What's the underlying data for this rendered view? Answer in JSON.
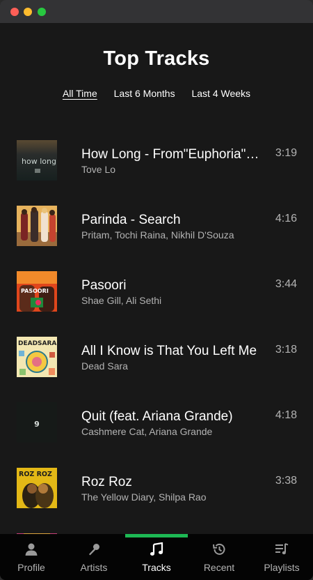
{
  "page": {
    "title": "Top Tracks"
  },
  "ranges": [
    {
      "label": "All Time",
      "active": true
    },
    {
      "label": "Last 6 Months",
      "active": false
    },
    {
      "label": "Last 4 Weeks",
      "active": false
    }
  ],
  "tracks": [
    {
      "name": "How Long - From\"Euphoria\" An HBO Original Series",
      "artists": "Tove Lo",
      "duration": "3:19",
      "cover_text": "how long"
    },
    {
      "name": "Parinda - Search",
      "artists": "Pritam, Tochi Raina, Nikhil D'Souza",
      "duration": "4:16",
      "cover_text": ""
    },
    {
      "name": "Pasoori",
      "artists": "Shae Gill, Ali Sethi",
      "duration": "3:44",
      "cover_text": "PASOORI"
    },
    {
      "name": "All I Know is That You Left Me",
      "artists": "Dead Sara",
      "duration": "3:18",
      "cover_text": "DEADSARA"
    },
    {
      "name": "Quit (feat. Ariana Grande)",
      "artists": "Cashmere Cat, Ariana Grande",
      "duration": "4:18",
      "cover_text": "9"
    },
    {
      "name": "Roz Roz",
      "artists": "The Yellow Diary, Shilpa Rao",
      "duration": "3:38",
      "cover_text": "ROZ ROZ"
    }
  ],
  "nav": [
    {
      "label": "Profile",
      "icon": "profile-icon",
      "active": false
    },
    {
      "label": "Artists",
      "icon": "microphone-icon",
      "active": false
    },
    {
      "label": "Tracks",
      "icon": "music-note-icon",
      "active": true
    },
    {
      "label": "Recent",
      "icon": "history-icon",
      "active": false
    },
    {
      "label": "Playlists",
      "icon": "playlist-icon",
      "active": false
    }
  ],
  "colors": {
    "accent": "#1db954",
    "background": "#181818",
    "navbar": "#040404",
    "muted_text": "#b3b3b3"
  }
}
